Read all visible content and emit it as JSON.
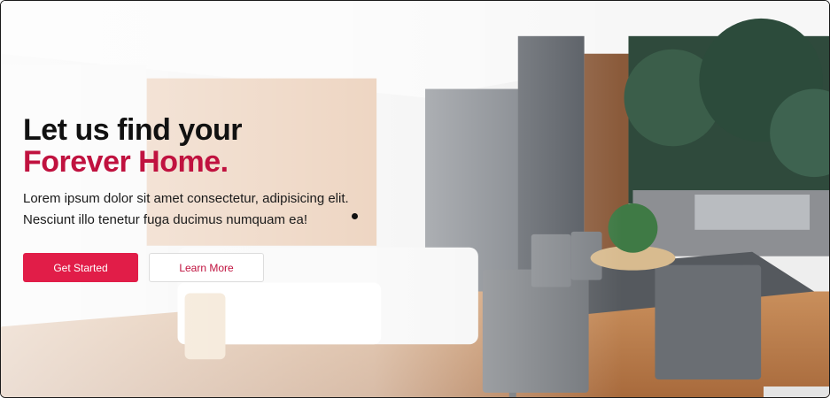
{
  "hero": {
    "headline_line1": "Let us find your",
    "headline_line2": "Forever Home.",
    "description": "Lorem ipsum dolor sit amet consectetur, adipisicing elit. Nesciunt illo tenetur fuga ducimus numquam ea!",
    "primary_button": "Get Started",
    "secondary_button": "Learn More"
  },
  "colors": {
    "accent": "#c0123f",
    "primary_button_bg": "#e11d48",
    "headline": "#111111"
  },
  "background_image": "modern-living-room-with-outdoor-dining-patio"
}
